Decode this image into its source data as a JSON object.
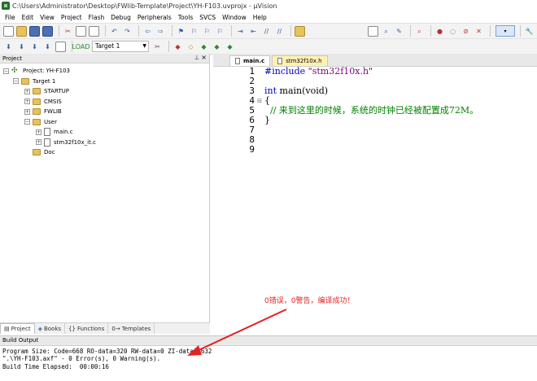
{
  "window": {
    "title": "C:\\Users\\Administrator\\Desktop\\FWlib-Template\\Project\\YH-F103.uvprojx - µVision"
  },
  "menu": [
    "File",
    "Edit",
    "View",
    "Project",
    "Flash",
    "Debug",
    "Peripherals",
    "Tools",
    "SVCS",
    "Window",
    "Help"
  ],
  "toolbar2": {
    "target": "Target 1"
  },
  "project_panel": {
    "title": "Project",
    "tree": [
      {
        "label": "Project: YH-F103"
      },
      {
        "label": "Target 1"
      },
      {
        "label": "STARTUP"
      },
      {
        "label": "CMSIS"
      },
      {
        "label": "FWLIB"
      },
      {
        "label": "User"
      },
      {
        "label": "main.c"
      },
      {
        "label": "stm32f10x_it.c"
      },
      {
        "label": "Doc"
      }
    ],
    "tabs": [
      "Project",
      "Books",
      "Functions",
      "Templates"
    ]
  },
  "editor": {
    "tabs": [
      "main.c",
      "stm32f10x.h"
    ],
    "line_numbers": [
      "1",
      "2",
      "3",
      "4",
      "5",
      "6",
      "7",
      "8",
      "9"
    ],
    "code": {
      "l1_directive": "#include",
      "l1_string": " \"stm32f10x.h\"",
      "l3_type": "int",
      "l3_rest": " main(void)",
      "l4": "{",
      "l5": "  // 来到这里的时候，系统的时钟已经被配置成72M。",
      "l6": "}"
    }
  },
  "annotation": "0错误，0警告，编译成功！",
  "build_output": {
    "title": "Build Output",
    "lines": [
      "Program Size: Code=668 RO-data=320 RW-data=0 ZI-data=1632",
      "\".\\YH-F103.axf\" - 0 Error(s), 0 Warning(s).",
      "Build Time Elapsed:  00:00:16"
    ]
  },
  "colors": {
    "annotation": "#e52222",
    "comment": "#008000",
    "keyword": "#0000c0",
    "string": "#7f007f"
  }
}
